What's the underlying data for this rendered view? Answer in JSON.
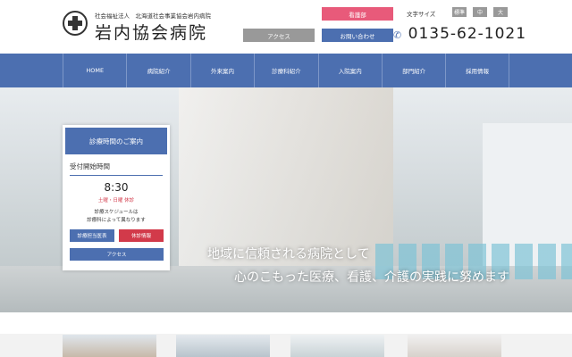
{
  "header": {
    "org": "社会福祉法人　北海道社会事業協会岩内病院",
    "name": "岩内協会病院",
    "nursing": "看護部",
    "access": "アクセス",
    "contact": "お問い合わせ",
    "font_size_label": "文字サイズ",
    "font_sizes": [
      "標準",
      "中",
      "大"
    ],
    "phone": "0135-62-1021"
  },
  "nav": [
    "HOME",
    "病院紹介",
    "外来案内",
    "診療科紹介",
    "入院案内",
    "部門紹介",
    "採用情報"
  ],
  "hero": {
    "line1": "地域に信頼される病院として",
    "line2": "心のこもった医療、看護、介護の実践に努めます"
  },
  "panel": {
    "title": "診療時間のご案内",
    "label": "受付開始時間",
    "time": "8:30",
    "closed": "土曜・日曜 休診",
    "note1": "診療スケジュールは",
    "note2": "診療科によって異なります",
    "schedule": "診療担当医表",
    "holiday": "休診情報",
    "access": "アクセス"
  },
  "colors": {
    "blue": "#4c6fb0",
    "pink": "#e85a7a",
    "red": "#d23a4a",
    "gray": "#999999"
  }
}
